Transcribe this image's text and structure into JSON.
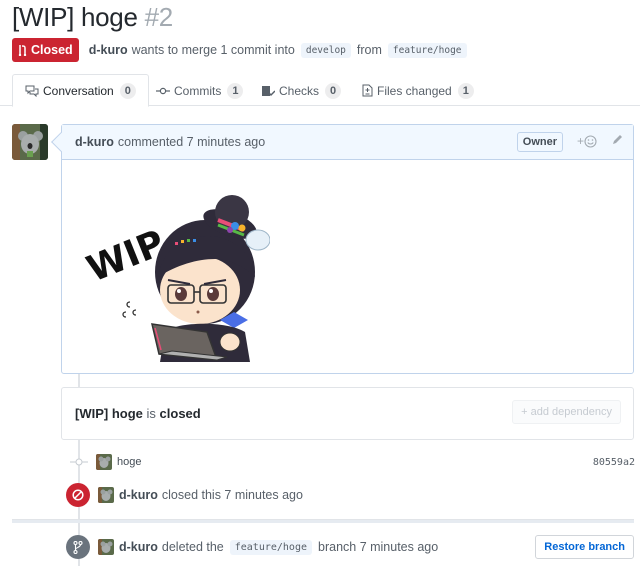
{
  "header": {
    "title": "[WIP] hoge",
    "number": "#2",
    "state_label": "Closed",
    "state_color": "#cb2431",
    "author": "d-kuro",
    "merge_text": "wants to merge 1 commit into",
    "base_branch": "develop",
    "from_text": "from",
    "head_branch": "feature/hoge"
  },
  "tabs": [
    {
      "label": "Conversation",
      "count": "0",
      "icon": "comment-discussion-icon",
      "selected": true
    },
    {
      "label": "Commits",
      "count": "1",
      "icon": "git-commit-icon",
      "selected": false
    },
    {
      "label": "Checks",
      "count": "0",
      "icon": "checklist-icon",
      "selected": false
    },
    {
      "label": "Files changed",
      "count": "1",
      "icon": "file-diff-icon",
      "selected": false
    }
  ],
  "comment": {
    "author": "d-kuro",
    "action": "commented 7 minutes ago",
    "role_badge": "Owner",
    "reaction_label": "+",
    "image_text": "WIP",
    "image_alt": "WIP sticker of anime girl with laptop"
  },
  "merge_status": {
    "title": "[WIP] hoge",
    "is_text": "is",
    "status": "closed",
    "add_dependency_label": "+ add dependency"
  },
  "timeline": {
    "commit": {
      "message": "hoge",
      "sha": "80559a2"
    },
    "closed_event": {
      "author": "d-kuro",
      "text": "closed this 7 minutes ago",
      "color": "#cb2431"
    },
    "deleted_event": {
      "author": "d-kuro",
      "text_before": "deleted the",
      "branch": "feature/hoge",
      "text_after": "branch 7 minutes ago",
      "color": "#6a737d"
    },
    "restore_label": "Restore branch"
  },
  "colors": {
    "link": "#0366d6",
    "comment_header_bg": "#f1f8ff",
    "comment_border": "#c0d3eb"
  }
}
